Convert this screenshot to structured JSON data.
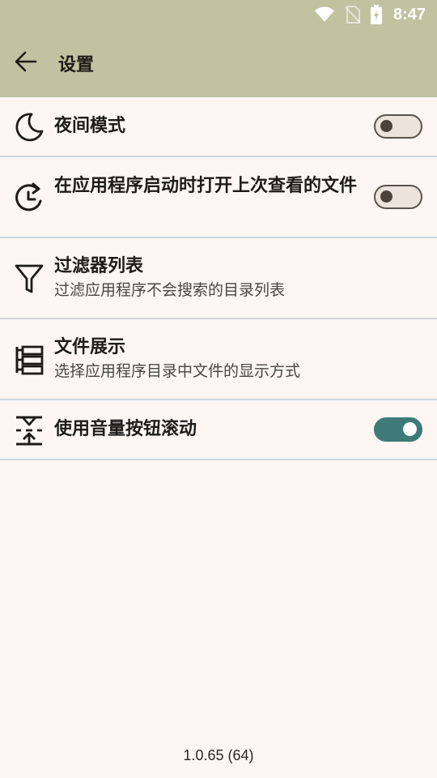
{
  "status_bar": {
    "time": "8:47",
    "icons": [
      "wifi-icon",
      "no-sim-icon",
      "battery-charging-icon"
    ]
  },
  "app_bar": {
    "back_icon": "arrow-left-icon",
    "title": "设置"
  },
  "settings": [
    {
      "id": "night-mode",
      "icon": "moon-icon",
      "title": "夜间模式",
      "subtitle": "",
      "toggle": "off"
    },
    {
      "id": "open-last-file",
      "icon": "restore-icon",
      "title": "在应用程序启动时打开上次查看的文件",
      "subtitle": "",
      "toggle": "off"
    },
    {
      "id": "filter-list",
      "icon": "filter-icon",
      "title": "过滤器列表",
      "subtitle": "过滤应用程序不会搜索的目录列表"
    },
    {
      "id": "file-display",
      "icon": "file-tree-icon",
      "title": "文件展示",
      "subtitle": "选择应用程序目录中文件的显示方式"
    },
    {
      "id": "volume-scroll",
      "icon": "vertical-scroll-icon",
      "title": "使用音量按钮滚动",
      "subtitle": "",
      "toggle": "on"
    }
  ],
  "version": "1.0.65 (64)",
  "colors": {
    "app_bar": "#c0c2a0",
    "background": "#fdf6f3",
    "divider": "#c9d6e3",
    "toggle_on": "#3d7a78"
  }
}
